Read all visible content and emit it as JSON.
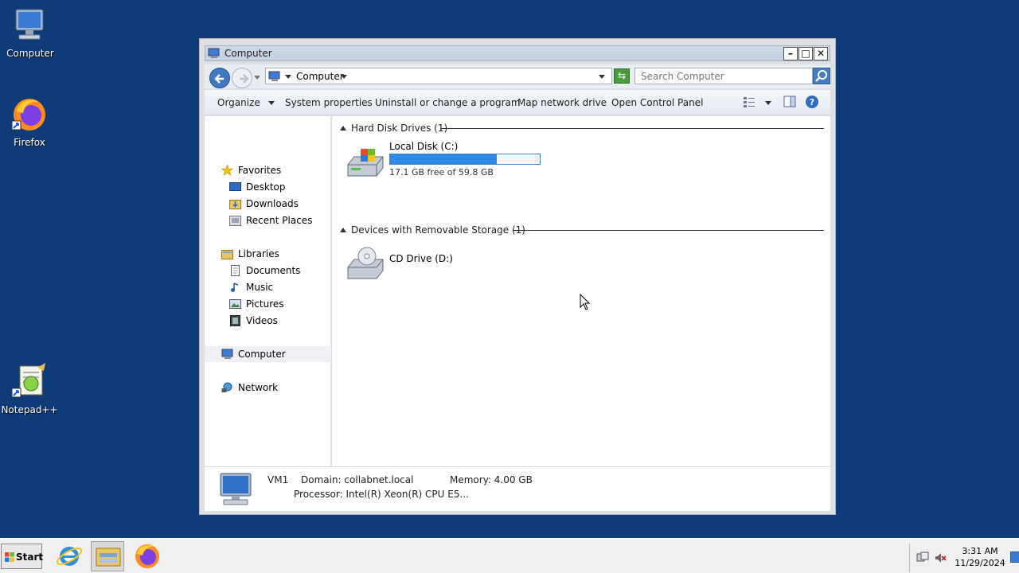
{
  "desktop": {
    "icons": [
      {
        "label": "Computer",
        "icon": "computer-icon"
      },
      {
        "label": "Firefox",
        "icon": "firefox-icon"
      },
      {
        "label": "Notepad++",
        "icon": "notepadpp-icon"
      }
    ]
  },
  "window": {
    "title": "Computer",
    "controls": {
      "minimize": "–",
      "maximize": "□",
      "close": "✕"
    },
    "address": {
      "crumb": "Computer"
    },
    "search": {
      "placeholder": "Search Computer"
    },
    "toolbar": {
      "organize": "Organize",
      "system_properties": "System properties",
      "uninstall": "Uninstall or change a program",
      "map_drive": "Map network drive",
      "control_panel": "Open Control Panel"
    },
    "nav": {
      "favorites": "Favorites",
      "desktop": "Desktop",
      "downloads": "Downloads",
      "recent": "Recent Places",
      "libraries": "Libraries",
      "documents": "Documents",
      "music": "Music",
      "pictures": "Pictures",
      "videos": "Videos",
      "computer": "Computer",
      "network": "Network"
    },
    "groups": {
      "hdd": "Hard Disk Drives (1)",
      "removable": "Devices with Removable Storage (1)"
    },
    "drives": {
      "c": {
        "name": "Local Disk (C:)",
        "free_text": "17.1 GB free of 59.8 GB",
        "used_fraction": 0.714
      },
      "d": {
        "name": "CD Drive (D:)"
      }
    },
    "details": {
      "name": "VM1",
      "domain": "Domain: collabnet.local",
      "memory": "Memory: 4.00 GB",
      "processor": "Processor: Intel(R) Xeon(R) CPU E5..."
    }
  },
  "taskbar": {
    "start": "Start",
    "apps": [
      "internet-explorer-icon",
      "file-explorer-icon",
      "firefox-icon"
    ],
    "time": "3:31 AM",
    "date": "11/29/2024"
  },
  "colors": {
    "desktop_bg": "#0f3b78",
    "progress": "#2e8ae6"
  }
}
